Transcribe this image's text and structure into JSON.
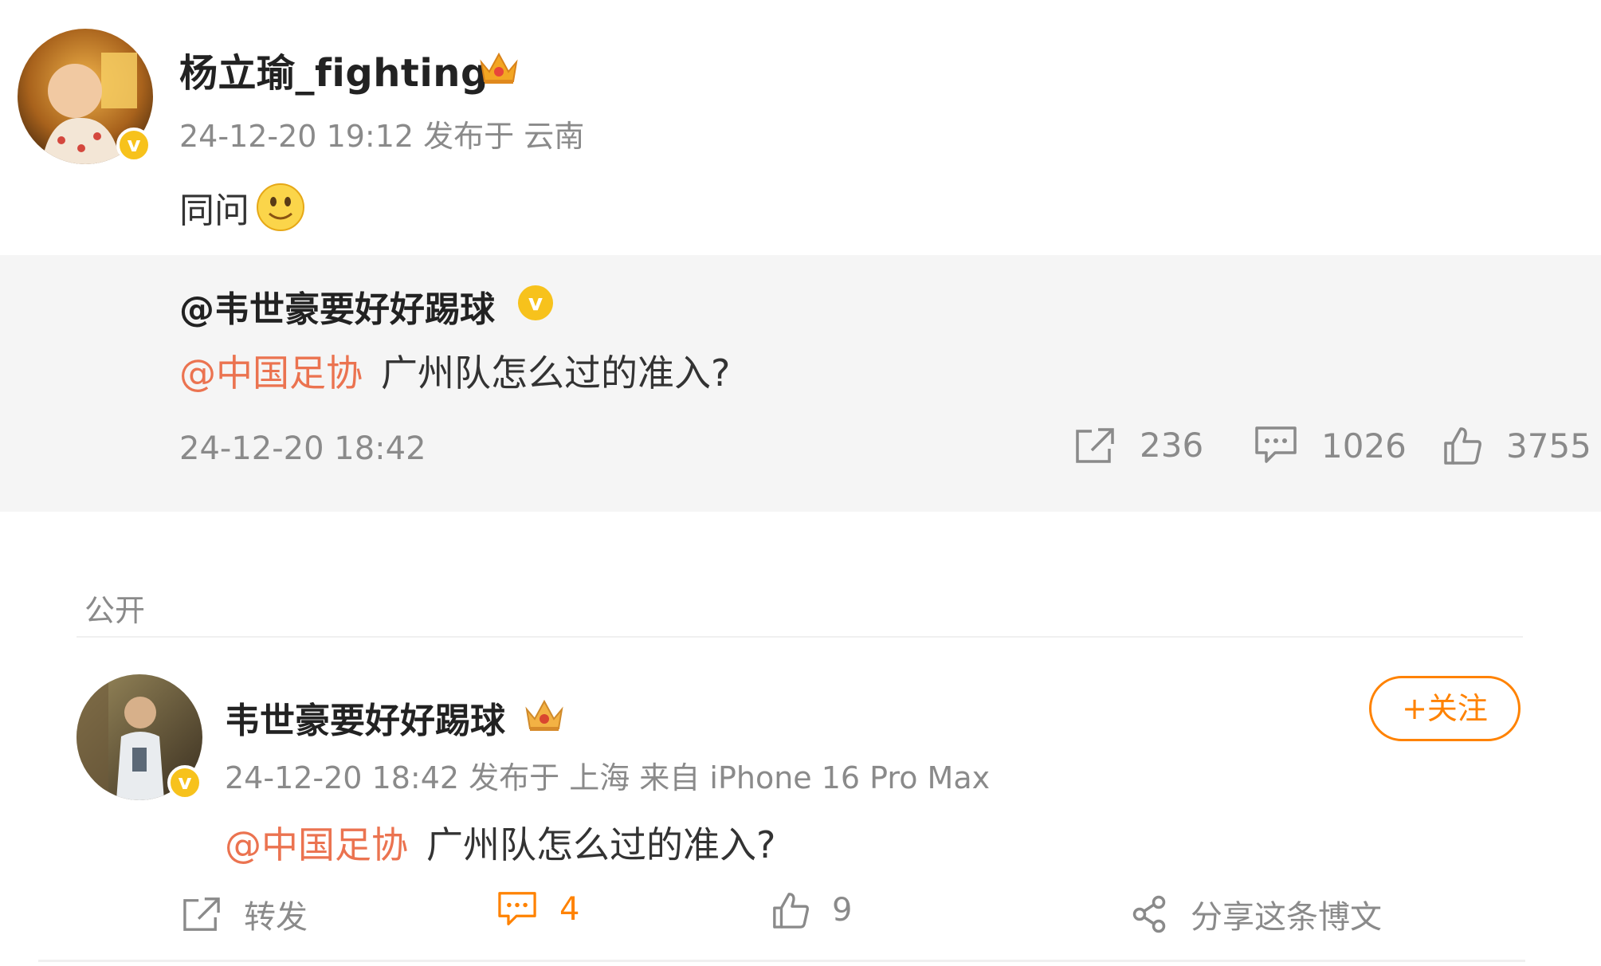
{
  "post": {
    "author": "杨立瑜_fighting",
    "timestamp": "24-12-20 19:12",
    "location_label": "发布于 云南",
    "text": "同问"
  },
  "quoted": {
    "author": "@韦世豪要好好踢球",
    "mention": "@中国足协",
    "text": "广州队怎么过的准入?",
    "timestamp": "24-12-20 18:42",
    "reposts": "236",
    "comments": "1026",
    "likes": "3755"
  },
  "section_label": "公开",
  "comment": {
    "author": "韦世豪要好好踢球",
    "meta": "24-12-20 18:42 发布于 上海 来自 iPhone 16 Pro Max",
    "mention": "@中国足协",
    "text": "广州队怎么过的准入?",
    "follow_label": "+关注",
    "actions": {
      "repost_label": "转发",
      "comment_count": "4",
      "like_count": "9",
      "share_label": "分享这条博文"
    }
  },
  "icons": {
    "badge": "verified-v-icon",
    "crown": "crown-icon",
    "emoji": "smiley-emoji-icon",
    "repost": "repost-icon",
    "comment": "comment-icon",
    "like": "like-icon",
    "share": "share-icon"
  },
  "colors": {
    "accent": "#ff8200",
    "mention": "#eb7350",
    "verified": "#f7c21c",
    "quote_bg": "#f5f5f5"
  }
}
